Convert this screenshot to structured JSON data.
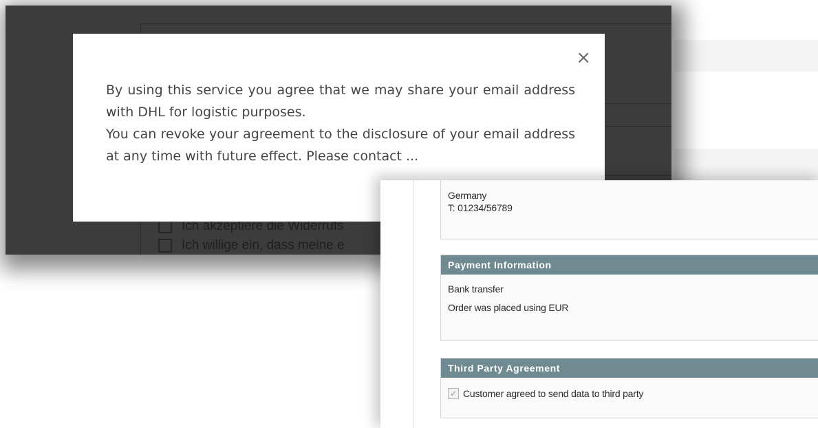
{
  "modal": {
    "close_glyph": "×",
    "paragraph1": "By using this service you agree that we may share your email address with DHL for logistic purposes.",
    "paragraph2": "You can revoke your agreement to the disclosure of your email address at any time with future effect. Please contact ..."
  },
  "background_checkout": {
    "checkbox1_label": "Ich akzeptiere die Widerrufs",
    "checkbox2_label": "Ich willige ein, dass meine e"
  },
  "admin_order": {
    "address": {
      "country": "Germany",
      "phone": "T: 01234/56789"
    },
    "payment_information": {
      "title": "Payment Information",
      "method": "Bank transfer",
      "currency_note": "Order was placed using EUR"
    },
    "third_party_agreement": {
      "title": "Third Party Agreement",
      "checkbox_label": "Customer agreed to send data to third party",
      "checkbox_checked": true
    }
  },
  "colors": {
    "overlay": "#3c3c3c",
    "section_header": "#6f8a91",
    "modal_background": "#ffffff"
  }
}
